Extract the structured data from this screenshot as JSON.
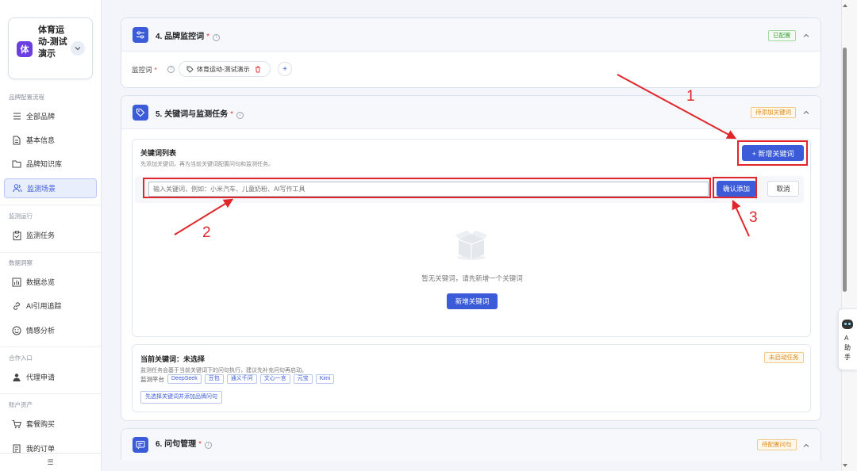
{
  "brand": {
    "logo_char": "体",
    "name": "体育运动-测试演示"
  },
  "sidebar": {
    "sections": [
      "品牌配置流程",
      "监测运行",
      "数据洞察",
      "合作入口",
      "账户资产"
    ],
    "items": [
      {
        "label": "全部品牌",
        "icon": "list-icon"
      },
      {
        "label": "基本信息",
        "icon": "document-icon"
      },
      {
        "label": "品牌知识库",
        "icon": "folder-icon"
      },
      {
        "label": "监测场景",
        "icon": "users-icon",
        "active": true
      },
      {
        "label": "监测任务",
        "icon": "clipboard-icon"
      },
      {
        "label": "数据总览",
        "icon": "chart-icon"
      },
      {
        "label": "AI引用追踪",
        "icon": "link-icon"
      },
      {
        "label": "情感分析",
        "icon": "smile-icon"
      },
      {
        "label": "代理申请",
        "icon": "agent-icon"
      },
      {
        "label": "套餐购买",
        "icon": "cart-icon"
      },
      {
        "label": "我的订单",
        "icon": "order-icon"
      }
    ],
    "footer_icon": "collapse-menu-icon",
    "footer_label": "☰"
  },
  "section4": {
    "title": "4. 品牌监控词",
    "required_mark": "*",
    "status": "已配置",
    "field_label": "监控词",
    "term": "体育运动-测试演示",
    "add_label": "+"
  },
  "section5": {
    "title": "5. 关键词与监测任务",
    "required_mark": "*",
    "status": "待添加关键词",
    "list_title": "关键词列表",
    "list_desc": "先添加关键词，再为当前关键词配置问句和监测任务。",
    "add_button": "+ 新增关键词",
    "input_placeholder": "输入关键词，例如：小米汽车、儿童奶粉、AI写作工具",
    "confirm_button": "确认添加",
    "cancel_button": "取消",
    "empty_text": "暂无关键词，请先新增一个关键词",
    "empty_button": "新增关键词",
    "current_title": "当前关键词：未选择",
    "current_status": "未启动任务",
    "current_desc": "监测任务会基于当前关键词下的问句执行，建议先补充问句再启动。",
    "platform_label": "监测平台",
    "platforms": [
      "DeepSeek",
      "豆包",
      "通义千问",
      "文心一言",
      "元宝",
      "Kimi"
    ],
    "select_button": "先选择关键词并添加品牌问句"
  },
  "section6": {
    "title": "6. 问句管理",
    "required_mark": "*",
    "status": "待配置问句"
  },
  "annotations": [
    "1",
    "2",
    "3"
  ],
  "assistant_tab": {
    "lines": [
      "A",
      "助",
      "手"
    ]
  },
  "colors": {
    "primary": "#3b5bd9",
    "annotation_red": "#e0262b",
    "brand_purple": "#6a3ee0"
  }
}
